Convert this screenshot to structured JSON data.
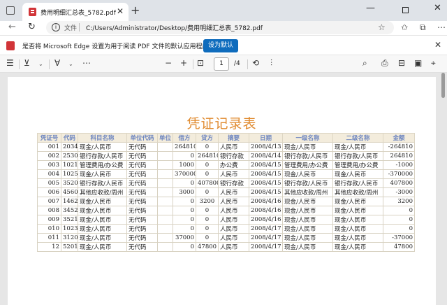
{
  "browser": {
    "tab_title": "费用明细汇总表_5782.pdf",
    "tab_close": "✕",
    "new_tab": "+",
    "address_label": "文件",
    "url": "C:/Users/Administrator/Desktop/费用明细汇总表_5782.pdf"
  },
  "infobar": {
    "message": "是否将 Microsoft Edge 设置为用于阅读 PDF 文件的默认应用程序?",
    "set_default_label": "设为默认",
    "close": "✕"
  },
  "pdf_toolbar": {
    "zoom_out": "−",
    "zoom_in": "+",
    "current_page": "1",
    "page_total": "/4"
  },
  "document": {
    "title": "凭证记录表",
    "columns": [
      "凭证号",
      "代码",
      "科目名称",
      "单位代码",
      "单位",
      "借方",
      "贷方",
      "摘要",
      "日期",
      "一级名称",
      "二级名称",
      "金额"
    ],
    "rows": [
      [
        "001",
        "2034",
        "现金/人民币",
        "无代码",
        "",
        "264810",
        "0",
        "人民币",
        "2008/4/13",
        "现金/人民币",
        "现金/人民币",
        "-264810"
      ],
      [
        "002",
        "2530",
        "银行存款/人民币",
        "无代码",
        "",
        "0",
        "264810",
        "银行存款",
        "2008/4/14",
        "银行存款/人民币",
        "银行存款/人民币",
        "264810"
      ],
      [
        "003",
        "1021",
        "管理费用/办公费",
        "无代码",
        "",
        "1000",
        "0",
        "办公费",
        "2008/4/15",
        "管理费用/办公费",
        "管理费用/办公费",
        "-1000"
      ],
      [
        "004",
        "1025",
        "现金/人民币",
        "无代码",
        "",
        "370000",
        "0",
        "人民币",
        "2008/4/15",
        "现金/人民币",
        "现金/人民币",
        "-370000"
      ],
      [
        "005",
        "3520",
        "银行存款/人民币",
        "无代码",
        "",
        "0",
        "407800",
        "银行存款",
        "2008/4/15",
        "银行存款/人民币",
        "银行存款/人民币",
        "407800"
      ],
      [
        "006",
        "4560",
        "其他应收款/周州",
        "无代码",
        "",
        "3000",
        "0",
        "人民币",
        "2008/4/15",
        "其他应收款/周州",
        "其他应收款/周州",
        "-3000"
      ],
      [
        "007",
        "1462",
        "现金/人民币",
        "无代码",
        "",
        "0",
        "3200",
        "人民币",
        "2008/4/16",
        "现金/人民币",
        "现金/人民币",
        "3200"
      ],
      [
        "008",
        "3452",
        "现金/人民币",
        "无代码",
        "",
        "0",
        "0",
        "人民币",
        "2008/4/16",
        "现金/人民币",
        "现金/人民币",
        "0"
      ],
      [
        "009",
        "3521",
        "现金/人民币",
        "无代码",
        "",
        "0",
        "0",
        "人民币",
        "2008/4/16",
        "现金/人民币",
        "现金/人民币",
        "0"
      ],
      [
        "010",
        "1023",
        "现金/人民币",
        "无代码",
        "",
        "0",
        "0",
        "人民币",
        "2008/4/17",
        "现金/人民币",
        "现金/人民币",
        "0"
      ],
      [
        "011",
        "3120",
        "现金/人民币",
        "无代码",
        "",
        "37000",
        "0",
        "人民币",
        "2008/4/17",
        "现金/人民币",
        "现金/人民币",
        "-37000"
      ],
      [
        "12",
        "5201",
        "现金/人民币",
        "无代码",
        "",
        "0",
        "47800",
        "人民币",
        "2008/4/17",
        "现金/人民币",
        "现金/人民币",
        "47800"
      ]
    ]
  }
}
